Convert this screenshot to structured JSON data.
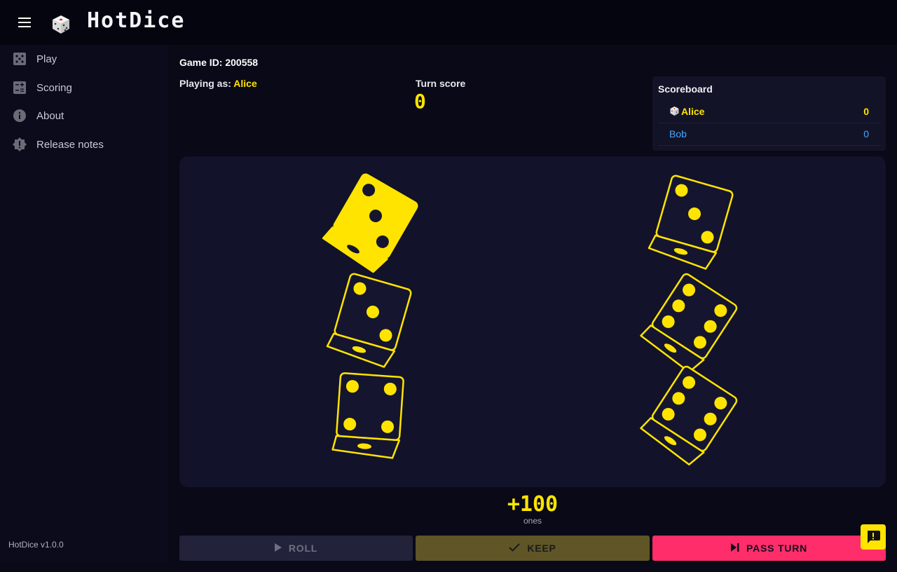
{
  "app": {
    "title": "HotDice",
    "version": "HotDice v1.0.0"
  },
  "header": {
    "menu_icon": "hamburger-menu-icon",
    "logo_icon": "dice-icon"
  },
  "nav": [
    {
      "label": "Play",
      "icon": "dice-five-icon"
    },
    {
      "label": "Scoring",
      "icon": "calculator-icon"
    },
    {
      "label": "About",
      "icon": "info-icon"
    },
    {
      "label": "Release notes",
      "icon": "badge-alert-icon"
    }
  ],
  "game": {
    "id_label": "Game ID: 200558",
    "playing_as_label": "Playing as:",
    "player": "Alice",
    "turn_score_label": "Turn score",
    "turn_score": "0"
  },
  "scoreboard": {
    "title": "Scoreboard",
    "players": [
      {
        "name": "Alice",
        "score": "0",
        "current": true
      },
      {
        "name": "Bob",
        "score": "0",
        "current": false
      }
    ]
  },
  "dice": [
    {
      "value": 3,
      "kept": true
    },
    {
      "value": 3,
      "kept": false
    },
    {
      "value": 4,
      "kept": false
    },
    {
      "value": 3,
      "kept": false
    },
    {
      "value": 6,
      "kept": false
    },
    {
      "value": 6,
      "kept": false
    }
  ],
  "result": {
    "points": "+100",
    "combo": "ones"
  },
  "actions": {
    "roll": "ROLL",
    "keep": "KEEP",
    "pass": "PASS TURN"
  },
  "colors": {
    "accent": "#ffe400",
    "danger": "#ff2d6a",
    "other_player": "#45a8ff",
    "background": "#090917",
    "die_face": "#151530"
  }
}
